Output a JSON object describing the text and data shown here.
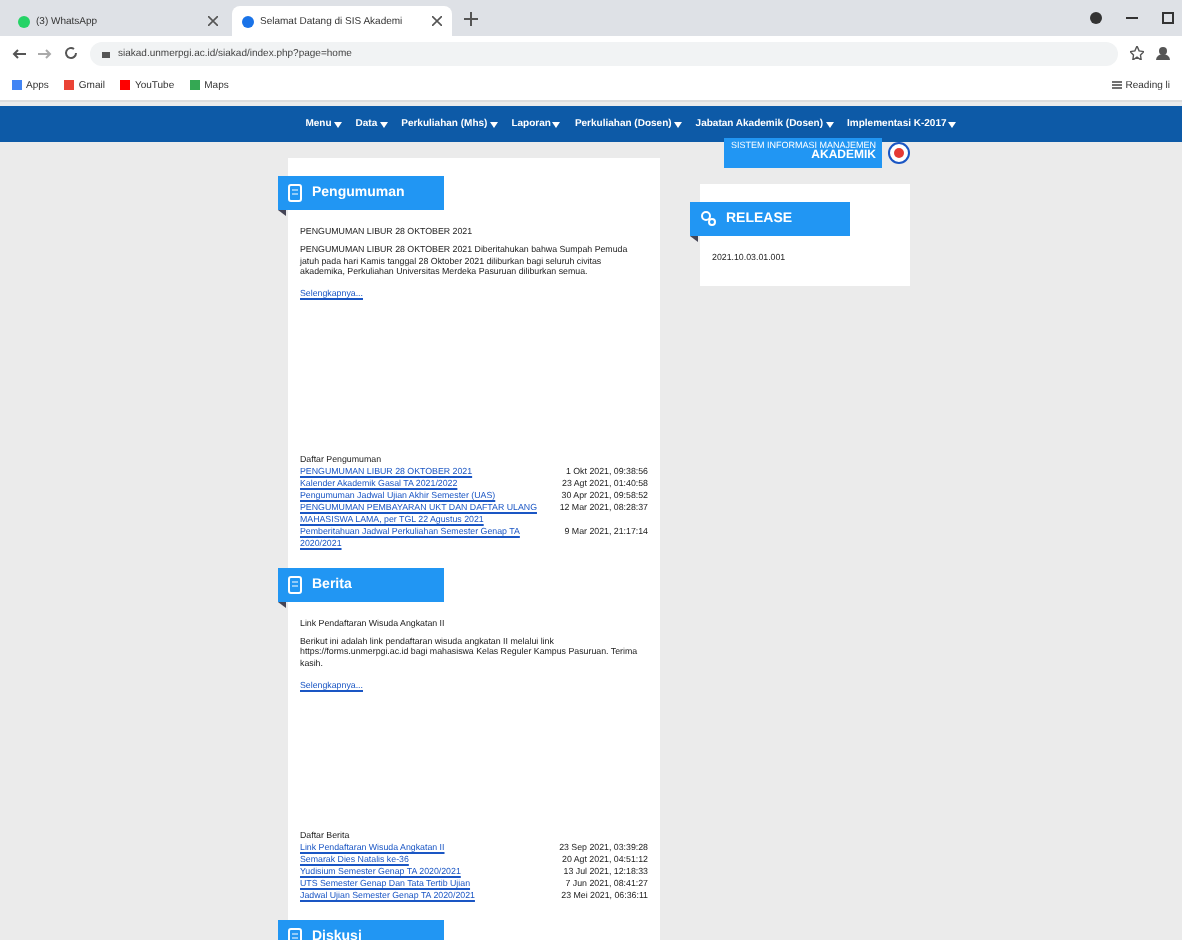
{
  "browser": {
    "tabs": [
      {
        "title": "(3) WhatsApp",
        "selected": false
      },
      {
        "title": "Selamat Datang di SIS Akademi",
        "selected": true
      }
    ],
    "url": "siakad.unmerpgi.ac.id/siakad/index.php?page=home",
    "bookmarks": [
      "Apps",
      "Gmail",
      "YouTube",
      "Maps"
    ],
    "reading_list": "Reading li"
  },
  "nav": {
    "items": [
      "Menu",
      "Data",
      "Perkuliahan (Mhs)",
      "Laporan",
      "Perkuliahan (Dosen)",
      "Jabatan Akademik (Dosen)",
      "Implementasi K-2017"
    ]
  },
  "badge": {
    "lines": [
      "SISTEM INFORMASI MANAJEMEN",
      "AKADEMIK"
    ]
  },
  "sections": [
    {
      "title": "Pengumuman",
      "headline": "PENGUMUMAN LIBUR 28 OKTOBER 2021",
      "body": "PENGUMUMAN LIBUR 28 OKTOBER 2021 Diberitahukan bahwa Sumpah Pemuda jatuh pada hari Kamis tanggal 28 Oktober 2021 diliburkan bagi seluruh civitas akademika, Perkuliahan Universitas Merdeka Pasuruan diliburkan semua.",
      "more": "Selengkapnya...",
      "list_title": "Daftar Pengumuman",
      "items": [
        {
          "text": "PENGUMUMAN LIBUR 28 OKTOBER 2021",
          "date": "1 Okt 2021, 09:38:56"
        },
        {
          "text": "Kalender Akademik Gasal TA 2021/2022",
          "date": "23 Agt 2021, 01:40:58"
        },
        {
          "text": "Pengumuman Jadwal Ujian Akhir Semester (UAS)",
          "date": "30 Apr 2021, 09:58:52"
        },
        {
          "text": "PENGUMUMAN PEMBAYARAN UKT DAN DAFTAR ULANG MAHASISWA LAMA, per TGL 22 Agustus 2021",
          "date": "12 Mar 2021, 08:28:37"
        },
        {
          "text": "Pemberitahuan Jadwal Perkuliahan Semester Genap TA 2020/2021",
          "date": "9 Mar 2021, 21:17:14"
        }
      ]
    },
    {
      "title": "Berita",
      "headline": "Link Pendaftaran Wisuda Angkatan II",
      "body": "Berikut ini adalah link pendaftaran wisuda angkatan II melalui link https://forms.unmerpgi.ac.id bagi mahasiswa Kelas Reguler Kampus Pasuruan. Terima kasih.",
      "more": "Selengkapnya...",
      "list_title": "Daftar Berita",
      "items": [
        {
          "text": "Link Pendaftaran Wisuda Angkatan II",
          "date": "23 Sep 2021, 03:39:28"
        },
        {
          "text": "Semarak Dies Natalis ke-36",
          "date": "20 Agt 2021, 04:51:12"
        },
        {
          "text": "Yudisium Semester Genap TA 2020/2021",
          "date": "13 Jul 2021, 12:18:33"
        },
        {
          "text": "UTS Semester Genap Dan Tata Tertib Ujian",
          "date": "7 Jun 2021, 08:41:27"
        },
        {
          "text": "Jadwal Ujian Semester Genap TA 2020/2021",
          "date": "23 Mei 2021, 06:36:11"
        }
      ]
    },
    {
      "title": "Diskusi"
    }
  ],
  "release": {
    "title": "RELEASE",
    "version": "2021.10.03.01.001"
  }
}
